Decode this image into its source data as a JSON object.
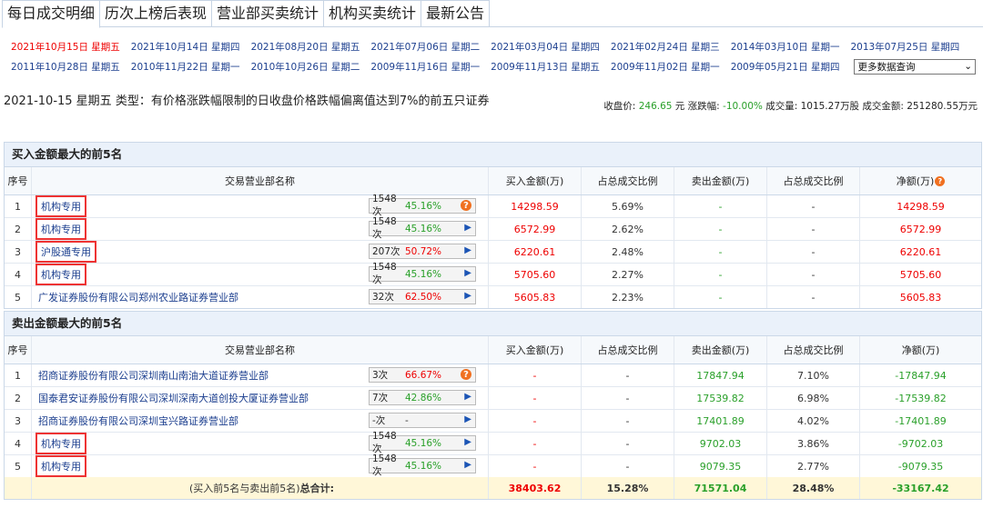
{
  "tabs": [
    "每日成交明细",
    "历次上榜后表现",
    "营业部买卖统计",
    "机构买卖统计",
    "最新公告"
  ],
  "dates_row1": [
    "2021年10月15日 星期五",
    "2021年10月14日 星期四",
    "2021年08月20日 星期五",
    "2021年07月06日 星期二",
    "2021年03月04日 星期四",
    "2021年02月24日 星期三",
    "2014年03月10日 星期一",
    "2013年07月25日 星期四"
  ],
  "dates_row2": [
    "2011年10月28日 星期五",
    "2010年11月22日 星期一",
    "2010年10月26日 星期二",
    "2009年11月16日 星期一",
    "2009年11月13日 星期五",
    "2009年11月02日 星期一",
    "2009年05月21日 星期四"
  ],
  "more_select": "更多数据查询",
  "summary": {
    "desc": "2021-10-15 星期五 类型：有价格涨跌幅限制的日收盘价格跌幅偏离值达到7%的前五只证券",
    "close_label": "收盘价: ",
    "close_value": "246.65",
    "close_unit": " 元 ",
    "change_label": "涨跌幅: ",
    "change_value": "-10.00%",
    "volume_label": " 成交量: ",
    "volume_value": "1015.27万股",
    "amount_label": " 成交金额: ",
    "amount_value": "251280.55万元"
  },
  "columns": [
    "序号",
    "交易营业部名称",
    "买入金额(万)",
    "占总成交比例",
    "卖出金额(万)",
    "占总成交比例",
    "净额(万)"
  ],
  "buy": {
    "title": "买入金额最大的前5名",
    "rows": [
      {
        "idx": "1",
        "name": "机构专用",
        "boxed": true,
        "count": "1548次",
        "pct": "45.16%",
        "pct_color": "#2aa02a",
        "icon": "info",
        "buy": "14298.59",
        "buy_ratio": "5.69%",
        "sell": "-",
        "sell_ratio": "-",
        "net": "14298.59"
      },
      {
        "idx": "2",
        "name": "机构专用",
        "boxed": true,
        "count": "1548次",
        "pct": "45.16%",
        "pct_color": "#2aa02a",
        "icon": "arrow",
        "buy": "6572.99",
        "buy_ratio": "2.62%",
        "sell": "-",
        "sell_ratio": "-",
        "net": "6572.99"
      },
      {
        "idx": "3",
        "name": "沪股通专用",
        "boxed": true,
        "count": "207次",
        "pct": "50.72%",
        "pct_color": "#e00",
        "icon": "arrow",
        "buy": "6220.61",
        "buy_ratio": "2.48%",
        "sell": "-",
        "sell_ratio": "-",
        "net": "6220.61"
      },
      {
        "idx": "4",
        "name": "机构专用",
        "boxed": true,
        "count": "1548次",
        "pct": "45.16%",
        "pct_color": "#2aa02a",
        "icon": "arrow",
        "buy": "5705.60",
        "buy_ratio": "2.27%",
        "sell": "-",
        "sell_ratio": "-",
        "net": "5705.60"
      },
      {
        "idx": "5",
        "name": "广发证券股份有限公司郑州农业路证券营业部",
        "boxed": false,
        "count": "32次",
        "pct": "62.50%",
        "pct_color": "#e00",
        "icon": "arrow",
        "buy": "5605.83",
        "buy_ratio": "2.23%",
        "sell": "-",
        "sell_ratio": "-",
        "net": "5605.83"
      }
    ]
  },
  "sell": {
    "title": "卖出金额最大的前5名",
    "rows": [
      {
        "idx": "1",
        "name": "招商证券股份有限公司深圳南山南油大道证券营业部",
        "boxed": false,
        "count": "3次",
        "pct": "66.67%",
        "pct_color": "#e00",
        "icon": "info",
        "buy": "-",
        "buy_ratio": "-",
        "sell": "17847.94",
        "sell_ratio": "7.10%",
        "net": "-17847.94"
      },
      {
        "idx": "2",
        "name": "国泰君安证券股份有限公司深圳深南大道创投大厦证券营业部",
        "boxed": false,
        "count": "7次",
        "pct": "42.86%",
        "pct_color": "#2aa02a",
        "icon": "arrow",
        "buy": "-",
        "buy_ratio": "-",
        "sell": "17539.82",
        "sell_ratio": "6.98%",
        "net": "-17539.82"
      },
      {
        "idx": "3",
        "name": "招商证券股份有限公司深圳宝兴路证券营业部",
        "boxed": false,
        "count": "-次",
        "pct": "-",
        "pct_color": "#333",
        "icon": "arrow",
        "buy": "-",
        "buy_ratio": "-",
        "sell": "17401.89",
        "sell_ratio": "4.02%",
        "net": "-17401.89"
      },
      {
        "idx": "4",
        "name": "机构专用",
        "boxed": true,
        "count": "1548次",
        "pct": "45.16%",
        "pct_color": "#2aa02a",
        "icon": "arrow",
        "buy": "-",
        "buy_ratio": "-",
        "sell": "9702.03",
        "sell_ratio": "3.86%",
        "net": "-9702.03"
      },
      {
        "idx": "5",
        "name": "机构专用",
        "boxed": true,
        "count": "1548次",
        "pct": "45.16%",
        "pct_color": "#2aa02a",
        "icon": "arrow",
        "buy": "-",
        "buy_ratio": "-",
        "sell": "9079.35",
        "sell_ratio": "2.77%",
        "net": "-9079.35"
      }
    ]
  },
  "total": {
    "label_prefix": "(买入前5名与卖出前5名)",
    "label_bold": "总合计:",
    "buy": "38403.62",
    "buy_ratio": "15.28%",
    "sell": "71571.04",
    "sell_ratio": "28.48%",
    "net": "-33167.42"
  },
  "colors": {
    "buy_text": "#e00",
    "sell_text": "#2aa02a",
    "link": "#1c3f8f"
  },
  "icons": {
    "info": "info-icon",
    "arrow": "arrow-right-icon",
    "help": "help-icon",
    "select": "chevron-down-icon"
  }
}
